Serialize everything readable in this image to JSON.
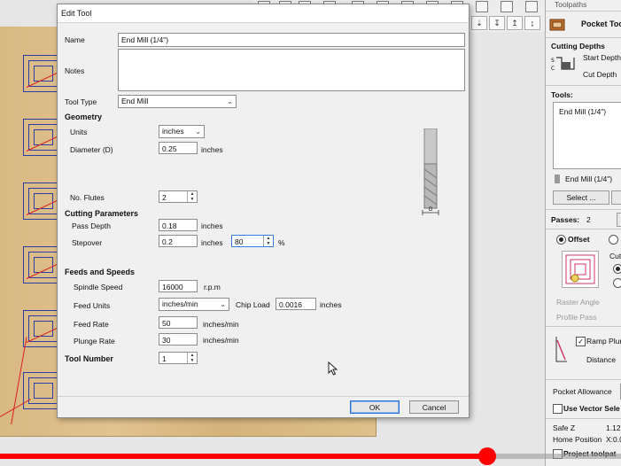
{
  "dialog": {
    "title": "Edit Tool",
    "name_label": "Name",
    "name_value": "End Mill (1/4\")",
    "notes_label": "Notes",
    "notes_value": "",
    "tool_type_label": "Tool Type",
    "tool_type_value": "End Mill",
    "geometry_header": "Geometry",
    "units_label": "Units",
    "units_value": "inches",
    "diameter_label": "Diameter (D)",
    "diameter_value": "0.25",
    "diameter_unit": "inches",
    "flutes_label": "No. Flutes",
    "flutes_value": "2",
    "cutting_header": "Cutting Parameters",
    "pass_depth_label": "Pass Depth",
    "pass_depth_value": "0.18",
    "pass_depth_unit": "inches",
    "stepover_label": "Stepover",
    "stepover_value": "0.2",
    "stepover_unit": "inches",
    "stepover_pct_value": "80",
    "stepover_pct_unit": "%",
    "feeds_header": "Feeds and Speeds",
    "spindle_label": "Spindle Speed",
    "spindle_value": "16000",
    "spindle_unit": "r.p.m",
    "feed_units_label": "Feed Units",
    "feed_units_value": "inches/min",
    "chip_load_label": "Chip Load",
    "chip_load_value": "0.0016",
    "chip_load_unit": "inches",
    "feed_rate_label": "Feed Rate",
    "feed_rate_value": "50",
    "feed_rate_unit": "inches/min",
    "plunge_rate_label": "Plunge Rate",
    "plunge_rate_value": "30",
    "plunge_rate_unit": "inches/min",
    "tool_number_label": "Tool Number",
    "tool_number_value": "1",
    "diagram_label": "D",
    "ok_label": "OK",
    "cancel_label": "Cancel"
  },
  "right_panel": {
    "header_partial": "Toolpaths",
    "pocket_title": "Pocket Too",
    "cutting_depths": "Cutting Depths",
    "start_depth": "Start Depth",
    "cut_depth": "Cut Depth",
    "tools_label": "Tools:",
    "tool_list_item": "End Mill (1/4\")",
    "tool_selected": "End Mill (1/4\")",
    "select_button": "Select ...",
    "passes_label": "Passes:",
    "passes_value": "2",
    "offset_label": "Offset",
    "cut_partial": "Cut",
    "raster_angle": "Raster Angle",
    "profile_pass": "Profile Pass",
    "ramp_plunge": "Ramp Plun",
    "distance_label": "Distance",
    "pocket_allowance": "Pocket Allowance",
    "use_vector": "Use Vector Sele",
    "safe_z": "Safe Z",
    "safe_z_value": "1.12",
    "home_position": "Home Position",
    "home_value": "X:0.0",
    "project_partial": "Project toolpat"
  },
  "video": {
    "progress_fraction": 0.785
  },
  "colors": {
    "progress": "#ff0000",
    "ok_border": "#2a6fd6",
    "toolpath": "#2a3da8",
    "link": "#d82020"
  }
}
